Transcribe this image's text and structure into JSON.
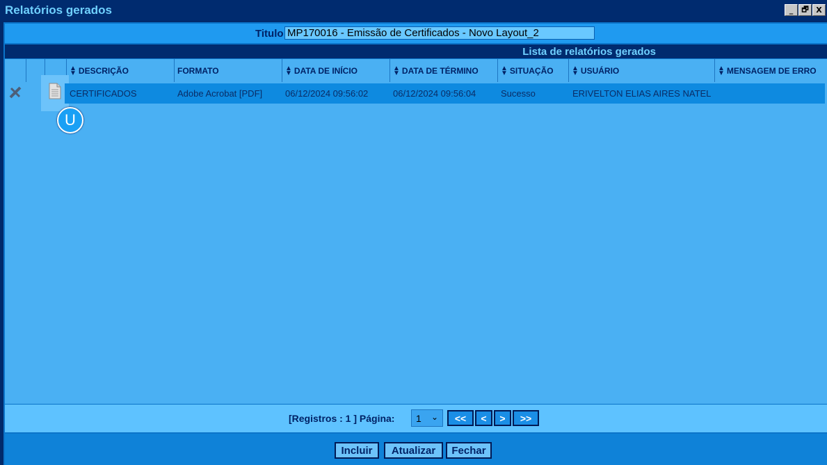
{
  "window": {
    "title": "Relatórios gerados",
    "buttons": [
      "_",
      "🗗",
      "X"
    ]
  },
  "titulo": {
    "label": "Titulo",
    "value": "MP170016 - Emissão de Certificados - Novo Layout_2"
  },
  "list": {
    "header": "Lista de relatórios gerados"
  },
  "columns": [
    "DESCRIÇÃO",
    "FORMATO",
    "DATA DE INÍCIO",
    "DATA DE TÉRMINO",
    "SITUAÇÃO",
    "USUÁRIO",
    "MENSAGEM DE ERRO"
  ],
  "rows": [
    {
      "descricao": "CERTIFICADOS",
      "formato": "Adobe Acrobat [PDF]",
      "inicio": "06/12/2024 09:56:02",
      "termino": "06/12/2024 09:56:04",
      "situacao": "Sucesso",
      "usuario": "ERIVELTON ELIAS AIRES NATEL",
      "mensagem": ""
    }
  ],
  "badge": "U",
  "pager": {
    "registros": "[Registros : 1 ] Página:",
    "page": "1",
    "first": "<<",
    "prev": "<",
    "next": ">",
    "last": ">>"
  },
  "footer": {
    "incluir": "Incluir",
    "atualizar": "Atualizar",
    "fechar": "Fechar"
  }
}
